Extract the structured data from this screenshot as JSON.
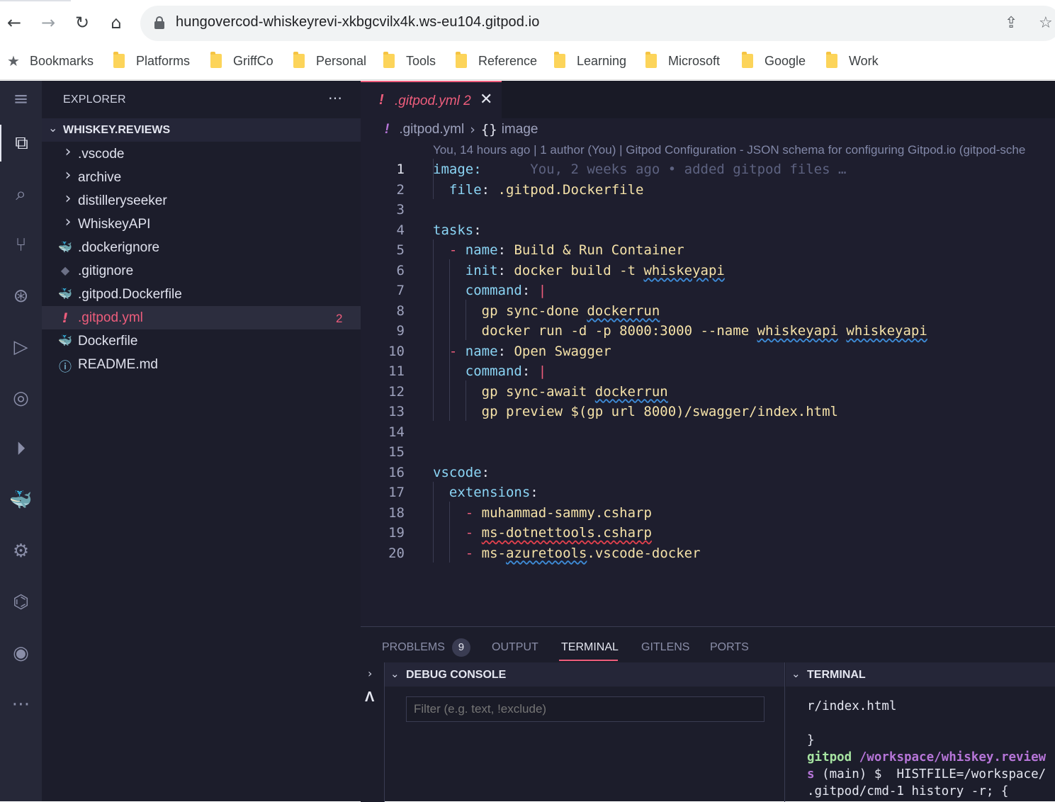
{
  "browser": {
    "url": "hungovercod-whiskeyrevi-xkbgcvilx4k.ws-eu104.gitpod.io",
    "bookmarks_label": "Bookmarks",
    "bookmark_folders": [
      "Platforms",
      "GriffCo",
      "Personal",
      "Tools",
      "Reference",
      "Learning",
      "Microsoft",
      "Google",
      "Work"
    ]
  },
  "explorer": {
    "title": "EXPLORER",
    "project": "WHISKEY.REVIEWS",
    "items": [
      {
        "label": ".vscode",
        "icon": "chevron-right-icon",
        "glyph": "›"
      },
      {
        "label": "archive",
        "icon": "chevron-right-icon",
        "glyph": "›"
      },
      {
        "label": "distilleryseeker",
        "icon": "chevron-right-icon",
        "glyph": "›"
      },
      {
        "label": "WhiskeyAPI",
        "icon": "chevron-right-icon",
        "glyph": "›"
      },
      {
        "label": ".dockerignore",
        "icon": "docker-icon",
        "glyph": "🐳"
      },
      {
        "label": ".gitignore",
        "icon": "git-icon",
        "glyph": "◆"
      },
      {
        "label": ".gitpod.Dockerfile",
        "icon": "docker-icon",
        "glyph": "🐳"
      },
      {
        "label": ".gitpod.yml",
        "icon": "yaml-warning-icon",
        "glyph": "!",
        "badge": "2"
      },
      {
        "label": "Dockerfile",
        "icon": "docker-icon",
        "glyph": "🐳"
      },
      {
        "label": "README.md",
        "icon": "info-icon",
        "glyph": "ⓘ"
      }
    ]
  },
  "editor": {
    "tab_label": ".gitpod.yml",
    "tab_badge": "2",
    "breadcrumb_file": ".gitpod.yml",
    "breadcrumb_symbol": "image",
    "codelens": "You, 14 hours ago | 1 author (You) | Gitpod Configuration - JSON schema for configuring Gitpod.io (gitpod-sche",
    "blame": "You, 2 weeks ago • added gitpod files …",
    "line_numbers": [
      "1",
      "2",
      "3",
      "4",
      "5",
      "6",
      "7",
      "8",
      "9",
      "10",
      "11",
      "12",
      "13",
      "14",
      "15",
      "16",
      "17",
      "18",
      "19",
      "20"
    ]
  },
  "panel": {
    "tabs": [
      "PROBLEMS",
      "OUTPUT",
      "TERMINAL",
      "GITLENS",
      "PORTS"
    ],
    "problems_count": "9",
    "debug_title": "DEBUG CONSOLE",
    "filter_placeholder": "Filter (e.g. text, !exclude)",
    "terminal_title": "TERMINAL",
    "terminal_lines": {
      "l1": "r/index.html",
      "l2": "}",
      "prompt_user": "gitpod",
      "prompt_path": "/workspace/whiskey.review",
      "l4a": "s",
      "l4b": " (main) $  HISTFILE=/workspace/",
      "l5": ".gitpod/cmd-1 history -r; {"
    }
  }
}
